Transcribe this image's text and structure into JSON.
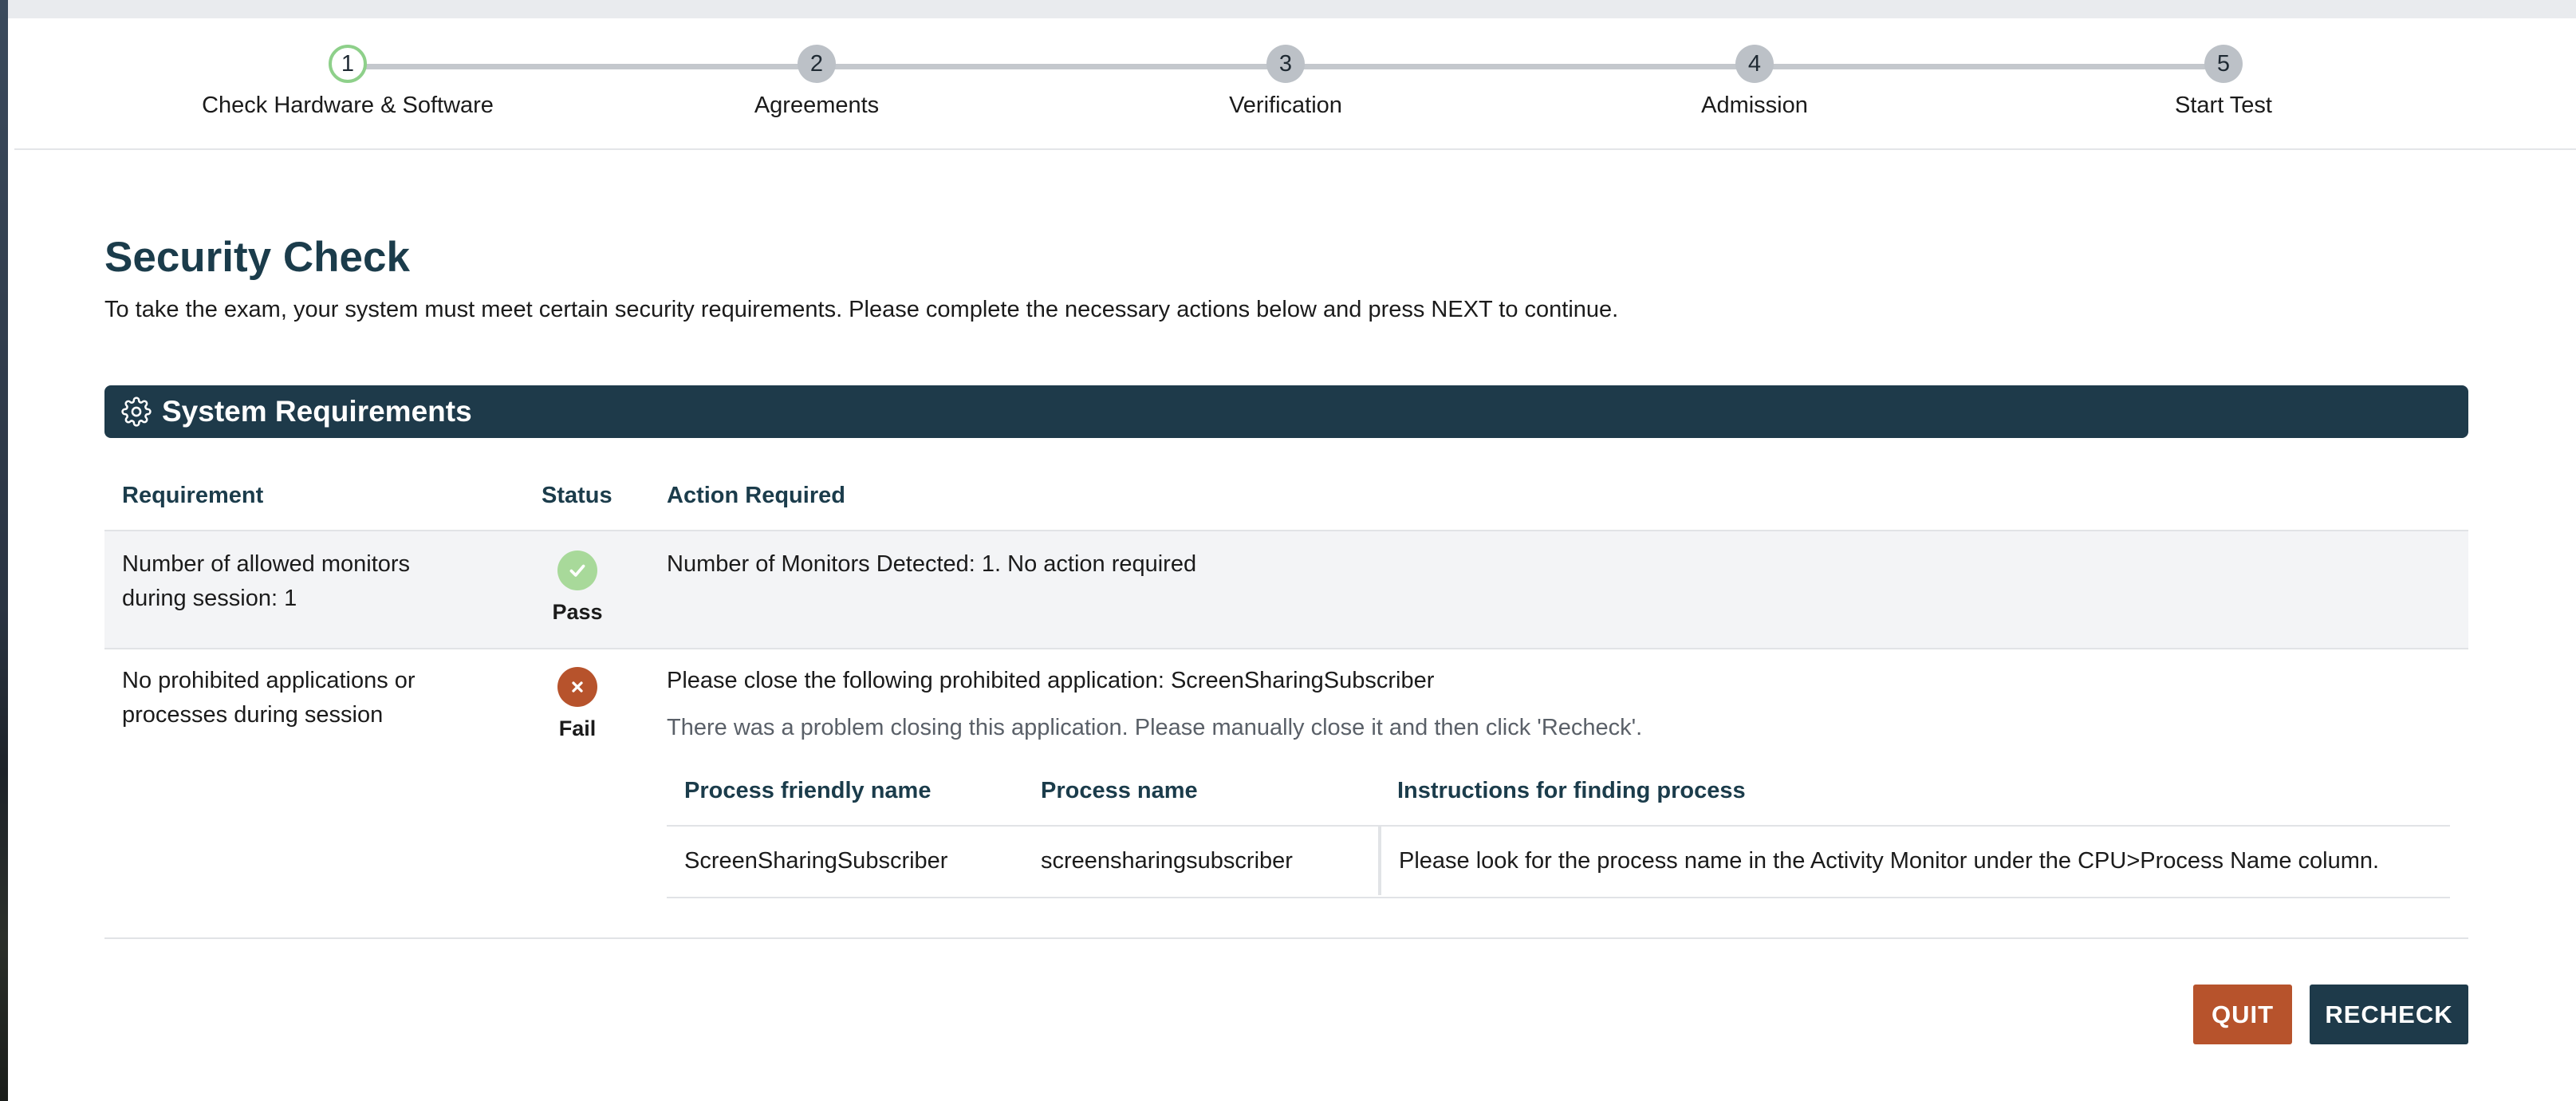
{
  "stepper": {
    "steps": [
      {
        "number": "1",
        "label": "Check Hardware & Software",
        "state": "active"
      },
      {
        "number": "2",
        "label": "Agreements",
        "state": "pending"
      },
      {
        "number": "3",
        "label": "Verification",
        "state": "pending"
      },
      {
        "number": "4",
        "label": "Admission",
        "state": "pending"
      },
      {
        "number": "5",
        "label": "Start Test",
        "state": "pending"
      }
    ]
  },
  "page": {
    "title": "Security Check",
    "intro": "To take the exam, your system must meet certain security requirements. Please complete the necessary actions below and press NEXT to continue."
  },
  "section": {
    "title": "System Requirements",
    "icon": "gear-icon"
  },
  "table": {
    "headers": {
      "requirement": "Requirement",
      "status": "Status",
      "action": "Action Required"
    },
    "rows": [
      {
        "requirement_line1": "Number of allowed monitors",
        "requirement_line2": "during session: 1",
        "status": "Pass",
        "status_icon": "check-icon",
        "action": "Number of Monitors Detected: 1. No action required"
      },
      {
        "requirement_line1": "No prohibited applications or",
        "requirement_line2": "processes during session",
        "status": "Fail",
        "status_icon": "close-icon",
        "action": "Please close the following prohibited application: ScreenSharingSubscriber",
        "note": "There was a problem closing this application. Please manually close it and then click 'Recheck'.",
        "process_table": {
          "headers": {
            "friendly": "Process friendly name",
            "name": "Process name",
            "instructions": "Instructions for finding process"
          },
          "rows": [
            {
              "friendly": "ScreenSharingSubscriber",
              "name": "screensharingsubscriber",
              "instructions": "Please look for the process name in the Activity Monitor under the CPU>Process Name column."
            }
          ]
        }
      }
    ]
  },
  "buttons": {
    "quit": "QUIT",
    "recheck": "RECHECK"
  },
  "colors": {
    "brand_dark": "#1e3a4a",
    "accent_orange": "#b7532c",
    "pass_green": "#a8d99a",
    "step_active_ring": "#8ed08a",
    "step_inactive": "#bcc1c7"
  }
}
